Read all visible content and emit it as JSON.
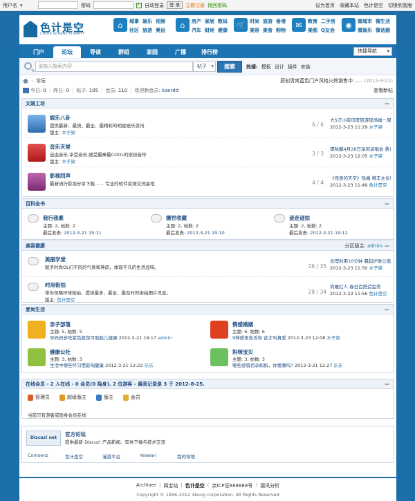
{
  "topbar": {
    "username_label": "用户名",
    "username_select": "▾",
    "password_label": "密码",
    "remember_label": "自动登录",
    "login_button": "登 录",
    "register_link": "立即注册",
    "forgot_link": "找回密码",
    "right_links": [
      "设为首页",
      "收藏本站",
      "色计是空",
      "切换到宽版"
    ]
  },
  "header": {
    "logo_name": "色计是空",
    "logo_sub": "COLOR SCHEME IS EMPTY",
    "nav_groups": [
      {
        "icon": "town-icon",
        "links": [
          "城事",
          "娱乐",
          "视频",
          "社区",
          "旅游",
          "奥运"
        ]
      },
      {
        "icon": "house-icon",
        "links": [
          "房产",
          "家居",
          "数码",
          "汽车",
          "财经",
          "健康"
        ]
      },
      {
        "icon": "cart-icon",
        "links": [
          "时尚",
          "旅游",
          "香港",
          "美容",
          "美食",
          "购物"
        ]
      },
      {
        "icon": "chat-icon",
        "links": [
          "教育",
          "二手房",
          "美图",
          "Q友会"
        ]
      },
      {
        "icon": "weibo-icon",
        "links": [
          "微城市",
          "微生活",
          "微娱乐",
          "微话题"
        ]
      }
    ]
  },
  "nav": {
    "tabs": [
      "门户",
      "论坛",
      "导读",
      "群组",
      "家园",
      "广播",
      "排行榜"
    ],
    "active_index": 1,
    "quick_nav": "快捷导航"
  },
  "search": {
    "placeholder": "请输入搜索内容",
    "scope": "帖子",
    "button": "搜索",
    "hot_label": "热搜:",
    "hot_words": [
      "模板",
      "设计",
      "插件",
      "安装"
    ]
  },
  "breadcrumb": {
    "current": "论坛",
    "announcement": "原创清爽蓝色门户风格火热销售中……",
    "announcement_date": "(2012-3-21)"
  },
  "stats": {
    "today_label": "今日:",
    "today": "0",
    "yesterday_label": "昨日:",
    "yesterday": "0",
    "posts_label": "帖子:",
    "posts": "105",
    "members_label": "会员:",
    "members": "110",
    "welcome_label": "欢迎新会员:",
    "welcome_user": "kaerdd",
    "newest_link": "查看新帖"
  },
  "groups": {
    "g1": {
      "title": "文娱工坊",
      "forums": [
        {
          "name": "娱乐八卦",
          "desc": "提供最新、最快、最全、最精彩的明星娱乐资讯",
          "mod_label": "版主:",
          "mod": "木子梁",
          "threads": "6",
          "posts": "6",
          "last_title": "大S汪小菲印度旅游现场婚一周年 …",
          "last_date": "2012-3-23 11:29",
          "last_user": "木子梁",
          "icon_color": "#4a7fc0"
        },
        {
          "name": "音乐天堂",
          "desc": "自由音乐,享受音乐,感受最棒最COOL的缤纷音符",
          "mod_label": "版主:",
          "mod": "木子梁",
          "threads": "3",
          "posts": "3",
          "last_title": "谭咏麟4月28日深圳演唱会 票价来民 …",
          "last_date": "2012-3-23 12:05",
          "last_user": "木子梁",
          "icon_color": "#d33030"
        },
        {
          "name": "影视同声",
          "desc": "最新流行影视分享下载…… 专业的软件资源交流基地",
          "mod_label": "",
          "mod": "",
          "threads": "4",
          "posts": "4",
          "last_title": "《怪兽的天空》热播 韩丰主论情侣 …",
          "last_date": "2012-3-23 11:49",
          "last_user": "色计是空",
          "icon_color": "#9b3a8d"
        }
      ]
    },
    "g2": {
      "title": "百科全书",
      "cells": [
        {
          "name": "我行我素",
          "threads_label": "主题:",
          "threads": "2",
          "posts_label": "帖数:",
          "posts": "2",
          "last_label": "最后发表:",
          "last": "2012-3-21 19:11"
        },
        {
          "name": "摄世收藏",
          "threads_label": "主题:",
          "threads": "2",
          "posts_label": "帖数:",
          "posts": "2",
          "last_label": "最后发表:",
          "last": "2012-3-21 19:10"
        },
        {
          "name": "迹走迹拍",
          "threads_label": "主题:",
          "threads": "2",
          "posts_label": "帖数:",
          "posts": "2",
          "last_label": "最后发表:",
          "last": "2012-3-21 19:12"
        }
      ]
    },
    "g3": {
      "title": "美容健康",
      "mod_label": "分区版主:",
      "mod": "admin",
      "forums": [
        {
          "name": "美丽学堂",
          "desc": "赋予时尚OL们不同的气质和神韵，体现不凡的生活品味。",
          "mod_label": "",
          "mod": "",
          "threads": "26",
          "posts": "35",
          "last_title": "合理利用10分钟 晨起护肤让肌肤美 …",
          "last_date": "2012-3-23 11:50",
          "last_user": "木子梁"
        },
        {
          "name": "时尚街拍",
          "desc": "带你领略环球街拍，提供最多，最全，最及时的街拍图片讯息。",
          "mod_label": "版主:",
          "mod": "色计是空",
          "threads": "28",
          "posts": "34",
          "last_title": "尚雕红人 春日百搭造型秀",
          "last_date": "2012-3-23 11:56",
          "last_user": "色计是空"
        }
      ]
    },
    "g4": {
      "title": "爱尚生活",
      "items": [
        {
          "name": "亲子部落",
          "l1": "主题: 5, 帖数: 5",
          "last_title": "孕妈妈多吃紫色蔬菜可助胎儿健康",
          "last_date": "2012-3-21 19:17",
          "last_user": "admin",
          "icon_color": "#f0b020"
        },
        {
          "name": "情感婚姻",
          "l1": "主题: 6, 帖数: 6",
          "last_title": "9种感觉告诉你 这才叫真爱",
          "last_date": "2012-3-23 12:08",
          "last_user": "木子梁",
          "icon_color": "#e04020"
        },
        {
          "name": "健康公社",
          "l1": "主题: 3, 帖数: 3",
          "last_title": "生活中哪些坏习惯影响健康",
          "last_date": "2012-3-21 12:22",
          "last_user": "乐乐",
          "icon_color": "#90c040"
        },
        {
          "name": "妈咪宝贝",
          "l1": "主题: 3, 帖数: 3",
          "last_title": "哪些感冒药孕妈妈，你要慕吗?",
          "last_date": "2012-3-21 12:27",
          "last_user": "乐乐",
          "icon_color": "#6cc060"
        }
      ]
    }
  },
  "online": {
    "title": "在线会员 - 2 人在线 - 0 会员(0 隐身), 2 位游客 - 最高记录是 3 于 2012-8-25.",
    "legend": [
      {
        "label": "管理员",
        "color": "#e05a2a"
      },
      {
        "label": "超级版主",
        "color": "#e09a20"
      },
      {
        "label": "版主",
        "color": "#3a7ac0"
      },
      {
        "label": "会员",
        "color": "#e0b030"
      }
    ],
    "message": "当前只有游客或隐身会员在线"
  },
  "links": {
    "logo_text": "Discuz! net",
    "name": "官方论坛",
    "desc": "提供最新 Discuz! 产品新闻、软件下载与技术交流",
    "text_links": [
      "Comsenz",
      "色计是空",
      "漫游平台",
      "Yeswan",
      "我的领地"
    ]
  },
  "footer": {
    "links": [
      "Archiver",
      "闽宝站",
      "色计是空",
      "京ICP证888888号",
      "漏讯分析"
    ],
    "copyright": "Copyright © 1996-2012 4kong corporation. All Rights Reserved"
  },
  "colors": {
    "primary": "#1d6ea7",
    "link": "#1d4d80",
    "accent_orange": "#e46b00"
  }
}
